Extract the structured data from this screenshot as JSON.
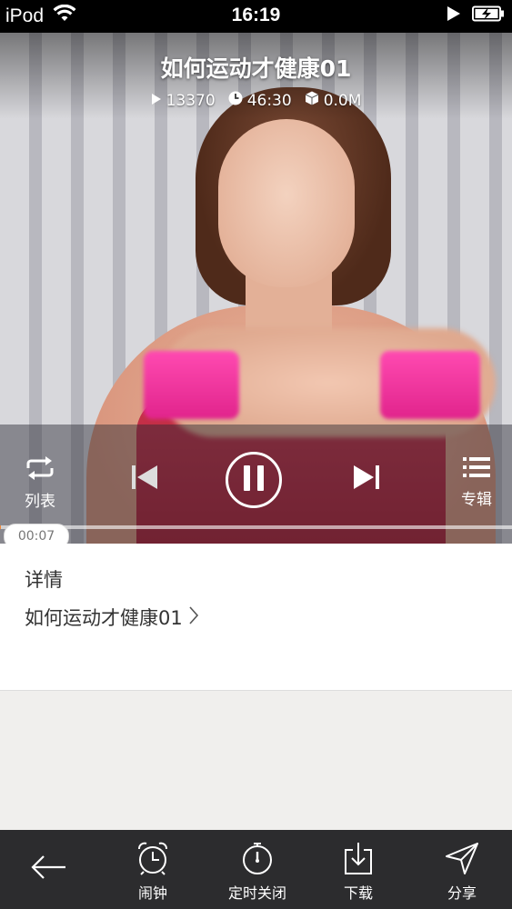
{
  "status_bar": {
    "device": "iPod",
    "time": "16:19"
  },
  "player": {
    "title": "如何运动才健康01",
    "play_count": "13370",
    "duration": "46:30",
    "file_size": "0.0M",
    "current_time": "00:07",
    "progress_fraction": 0.0025,
    "controls": {
      "list_label": "列表",
      "album_label": "专辑"
    }
  },
  "details": {
    "heading": "详情",
    "link_text": "如何运动才健康01"
  },
  "toolbar": {
    "alarm_label": "闹钟",
    "timer_label": "定时关闭",
    "download_label": "下载",
    "share_label": "分享"
  },
  "colors": {
    "accent": "#f08a3a",
    "toolbar_bg": "#2c2c2e",
    "page_bg": "#f0efed"
  }
}
